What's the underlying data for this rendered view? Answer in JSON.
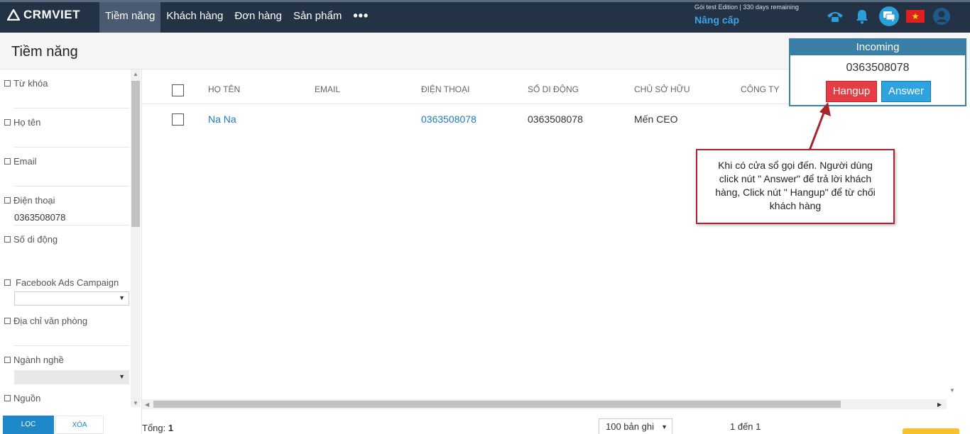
{
  "topbar": {
    "logo_text": "CRMVIET",
    "nav": [
      "Tiềm năng",
      "Khách hàng",
      "Đơn hàng",
      "Sản phẩm"
    ],
    "more": "•••",
    "plan_text": "Gói test Edition | 330 days remaining",
    "upgrade_label": "Nâng cấp",
    "flag_star": "★"
  },
  "page": {
    "title": "Tiềm năng"
  },
  "filters": {
    "keyword": "Từ khóa",
    "name": "Họ tên",
    "email": "Email",
    "phone": "Điện thoại",
    "phone_value": "0363508078",
    "mobile": "Số di động",
    "fb_campaign": "Facebook Ads Campaign",
    "office_address": "Địa chỉ văn phòng",
    "industry": "Ngành nghề",
    "source": "Nguồn",
    "filter_button": "LỌC",
    "clear_button": "XÓA"
  },
  "table": {
    "headers": [
      "HỌ TÊN",
      "EMAIL",
      "ĐIỆN THOẠI",
      "SỐ DI ĐỘNG",
      "CHỦ SỞ HỮU",
      "CÔNG TY"
    ],
    "rows": [
      {
        "name": "Na Na",
        "email": "",
        "phone": "0363508078",
        "mobile": "0363508078",
        "owner": "Mến CEO",
        "company": ""
      }
    ]
  },
  "footer": {
    "total_label": "Tổng:",
    "total_value": "1",
    "page_size": "100 bản ghi",
    "range": "1 đến 1"
  },
  "incoming": {
    "title": "Incoming",
    "number": "0363508078",
    "hangup_label": "Hangup",
    "answer_label": "Answer"
  },
  "annotation": {
    "text": "Khi có cửa sổ gọi đến. Người dùng click nút \" Answer\" để trả lời khách hàng, Click nút \" Hangup\" để từ chối khách hàng"
  },
  "colors": {
    "nav_bg": "#233345",
    "accent": "#1e88c8",
    "link": "#1e7ac2",
    "hangup": "#e63c46",
    "answer": "#2fa3e0",
    "annotation_border": "#a8232c"
  }
}
